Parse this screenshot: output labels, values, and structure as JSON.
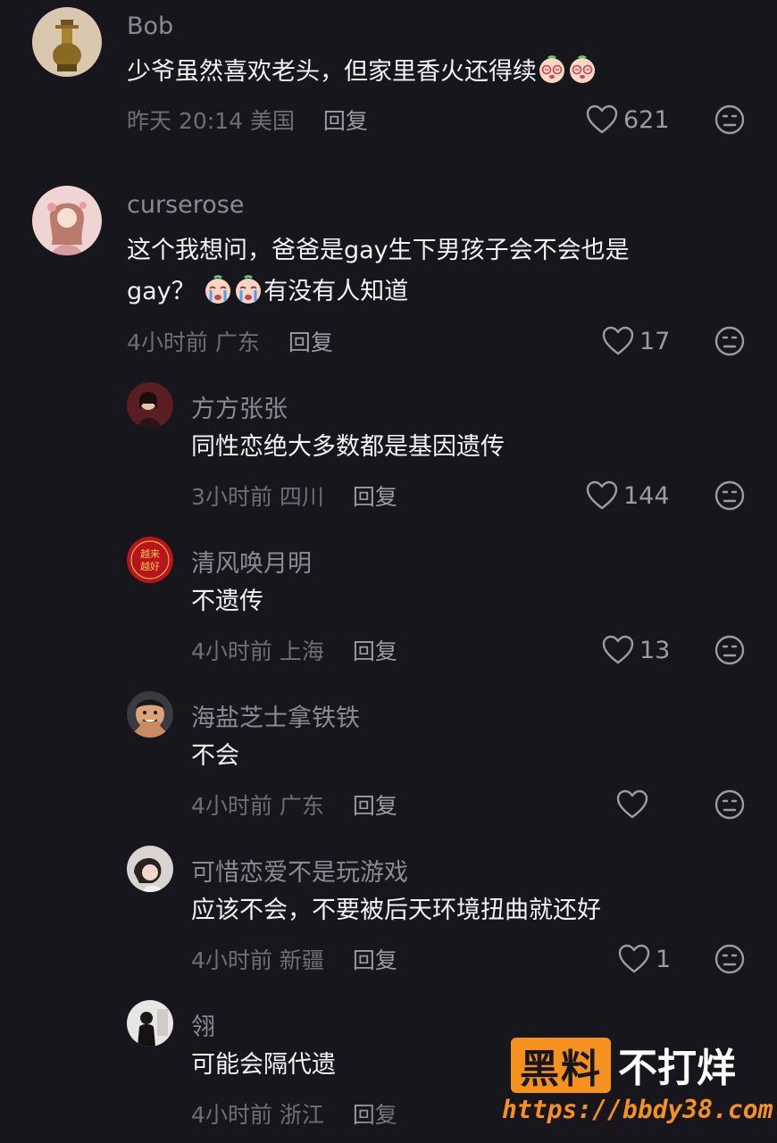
{
  "comments": [
    {
      "username": "Bob",
      "text": "少爷虽然喜欢老头，但家里香火还得续",
      "emojis": [
        "dizzy-face-emoji",
        "dizzy-face-emoji"
      ],
      "time": "昨天 20:14",
      "location": "美国",
      "reply_label": "回复",
      "likes": "621",
      "avatar": "golden-statue-avatar"
    },
    {
      "username": "curserose",
      "text_line1": "这个我想问，爸爸是gay生下男孩子会不会也是",
      "text_line2_prefix": "gay？",
      "text_line2_suffix": "有没有人知道",
      "emojis": [
        "crying-face-emoji",
        "crying-face-emoji"
      ],
      "time": "4小时前",
      "location": "广东",
      "reply_label": "回复",
      "likes": "17",
      "avatar": "pink-girl-avatar"
    },
    {
      "username": "方方张张",
      "text": "同性恋绝大多数都是基因遗传",
      "time": "3小时前",
      "location": "四川",
      "reply_label": "回复",
      "likes": "144",
      "avatar": "woman-portrait-avatar"
    },
    {
      "username": "清风唤月明",
      "text": "不遗传",
      "time": "4小时前",
      "location": "上海",
      "reply_label": "回复",
      "likes": "13",
      "avatar": "red-lucky-avatar",
      "avatar_text": "越来越好"
    },
    {
      "username": "海盐芝士拿铁铁",
      "text": "不会",
      "time": "4小时前",
      "location": "广东",
      "reply_label": "回复",
      "likes": "",
      "avatar": "man-smiling-avatar"
    },
    {
      "username": "可惜恋爱不是玩游戏",
      "text": "应该不会，不要被后天环境扭曲就还好",
      "time": "4小时前",
      "location": "新疆",
      "reply_label": "回复",
      "likes": "1",
      "avatar": "girl-photo-avatar"
    },
    {
      "username": "翎",
      "text": "可能会隔代遗",
      "time": "4小时前",
      "location": "浙江",
      "reply_label": "回复",
      "likes": "",
      "avatar": "dark-figure-avatar"
    }
  ],
  "watermark": {
    "box_text": "黑料",
    "text": "不打烊",
    "url": "https://bbdy38.com"
  },
  "colors": {
    "background": "#17161c",
    "username": "#8b8a93",
    "meta": "#6f6e76",
    "watermark_accent": "#f5911e"
  }
}
